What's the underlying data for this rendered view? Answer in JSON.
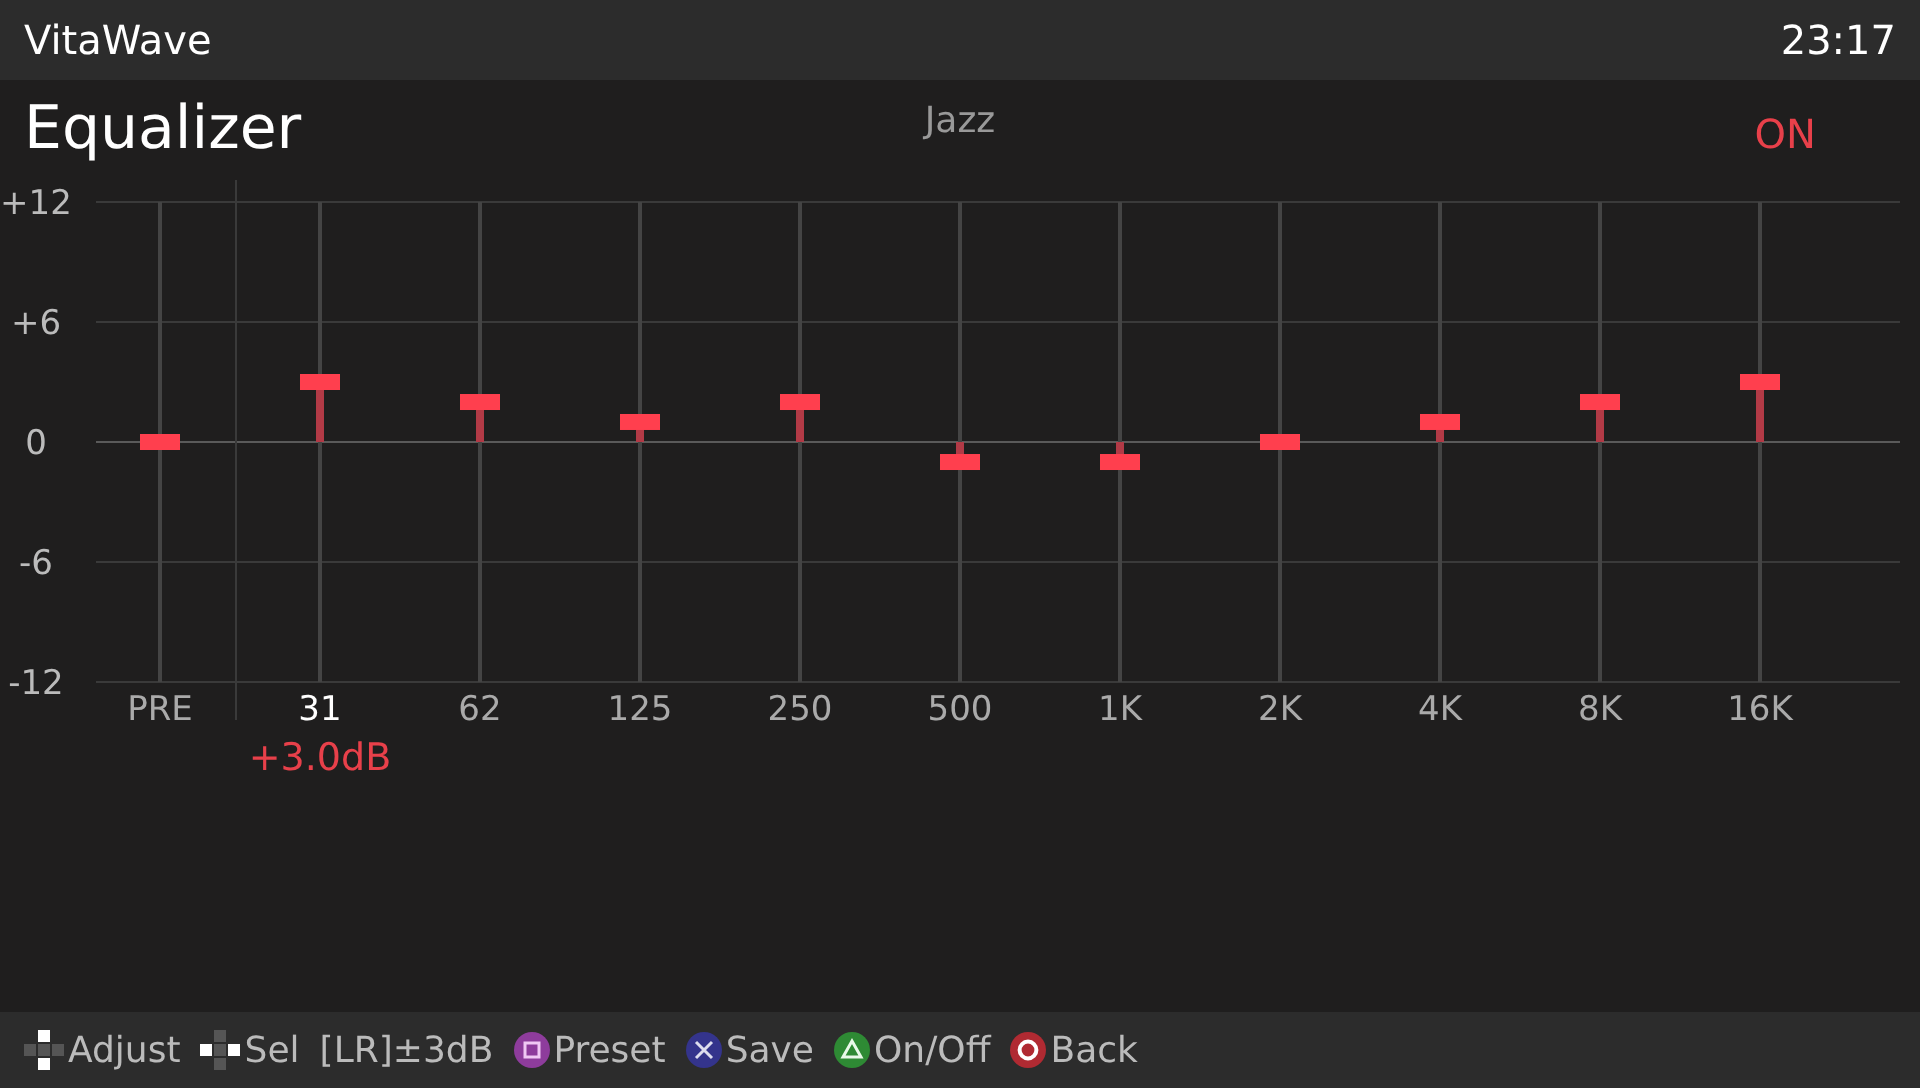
{
  "title_bar": {
    "app_name": "VitaWave",
    "clock": "23:17"
  },
  "header": {
    "title": "Equalizer",
    "preset": "Jazz",
    "power": {
      "label": "ON",
      "on": true
    }
  },
  "equalizer": {
    "scale": [
      "+12",
      "+6",
      "0",
      "-6",
      "-12"
    ],
    "bands": [
      {
        "label": "PRE",
        "level": 0.5,
        "selected": false
      },
      {
        "label": "31",
        "level": 0.625,
        "selected": true
      },
      {
        "label": "62",
        "level": 0.5833,
        "selected": false
      },
      {
        "label": "125",
        "level": 0.5417,
        "selected": false
      },
      {
        "label": "250",
        "level": 0.5833,
        "selected": false
      },
      {
        "label": "500",
        "level": 0.4583,
        "selected": false
      },
      {
        "label": "1K",
        "level": 0.4583,
        "selected": false
      },
      {
        "label": "2K",
        "level": 0.5,
        "selected": false
      },
      {
        "label": "4K",
        "level": 0.5417,
        "selected": false
      },
      {
        "label": "8K",
        "level": 0.5833,
        "selected": false
      },
      {
        "label": "16K",
        "level": 0.625,
        "selected": false
      }
    ],
    "readout": "+3.0dB"
  },
  "hints": [
    {
      "kind": "dpad_vertical",
      "label": "Adjust"
    },
    {
      "kind": "dpad_horizontal",
      "label": "Sel"
    },
    {
      "kind": "text",
      "label": "[LR]±3dB"
    },
    {
      "kind": "square",
      "label": "Preset"
    },
    {
      "kind": "cross",
      "label": "Save"
    },
    {
      "kind": "triangle",
      "label": "On/Off"
    },
    {
      "kind": "circle",
      "label": "Back"
    }
  ]
}
